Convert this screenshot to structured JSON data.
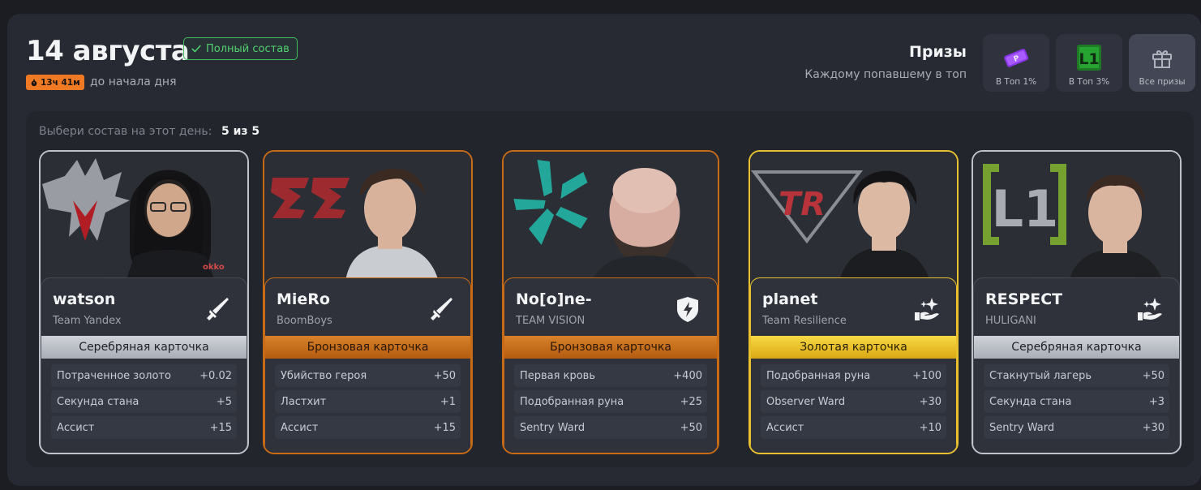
{
  "header": {
    "date": "14 августа",
    "status_badge": "Полный состав",
    "timer": "13ч 41м",
    "timer_suffix": "до начала дня"
  },
  "prizes": {
    "title": "Призы",
    "subtitle": "Каждому попавшему в топ",
    "tiles": [
      {
        "label": "В Топ 1%",
        "icon": "purple-ticket-icon"
      },
      {
        "label": "В Топ 3%",
        "icon": "l1-logo-icon"
      },
      {
        "label": "Все призы",
        "icon": "gift-icon"
      }
    ]
  },
  "lineup": {
    "pick_label": "Выбери состав на этот день:",
    "pick_count": "5 из 5",
    "cards": [
      {
        "player": "watson",
        "team": "Team Yandex",
        "role_icon": "sword-icon",
        "tier": "Серебряная карточка",
        "tier_type": "silver",
        "stats": [
          {
            "name": "Потраченное золото",
            "value": "+0.02"
          },
          {
            "name": "Секунда стана",
            "value": "+5"
          },
          {
            "name": "Ассист",
            "value": "+15"
          }
        ]
      },
      {
        "player": "MieRo",
        "team": "BoomBoys",
        "role_icon": "sword-icon",
        "tier": "Бронзовая карточка",
        "tier_type": "bronze",
        "stats": [
          {
            "name": "Убийство героя",
            "value": "+50"
          },
          {
            "name": "Ластхит",
            "value": "+1"
          },
          {
            "name": "Ассист",
            "value": "+15"
          }
        ]
      },
      {
        "player": "No[o]ne-",
        "team": "TEAM VISION",
        "role_icon": "shield-lightning-icon",
        "tier": "Бронзовая карточка",
        "tier_type": "bronze",
        "stats": [
          {
            "name": "Первая кровь",
            "value": "+400"
          },
          {
            "name": "Подобранная руна",
            "value": "+25"
          },
          {
            "name": "Sentry Ward",
            "value": "+50"
          }
        ]
      },
      {
        "player": "planet",
        "team": "Team Resilience",
        "role_icon": "hand-sparkle-icon",
        "tier": "Золотая карточка",
        "tier_type": "gold",
        "stats": [
          {
            "name": "Подобранная руна",
            "value": "+100"
          },
          {
            "name": "Observer Ward",
            "value": "+30"
          },
          {
            "name": "Ассист",
            "value": "+10"
          }
        ]
      },
      {
        "player": "RESPECT",
        "team": "HULIGANI",
        "role_icon": "hand-sparkle-icon",
        "tier": "Серебряная карточка",
        "tier_type": "silver",
        "stats": [
          {
            "name": "Стакнутый лагерь",
            "value": "+50"
          },
          {
            "name": "Секунда стана",
            "value": "+3"
          },
          {
            "name": "Sentry Ward",
            "value": "+30"
          }
        ]
      }
    ]
  },
  "colors": {
    "accent_green": "#51d16f",
    "timer_orange": "#f07a24",
    "silver": "#bfc3cc",
    "bronze": "#c76b17",
    "gold": "#e9c12f"
  }
}
